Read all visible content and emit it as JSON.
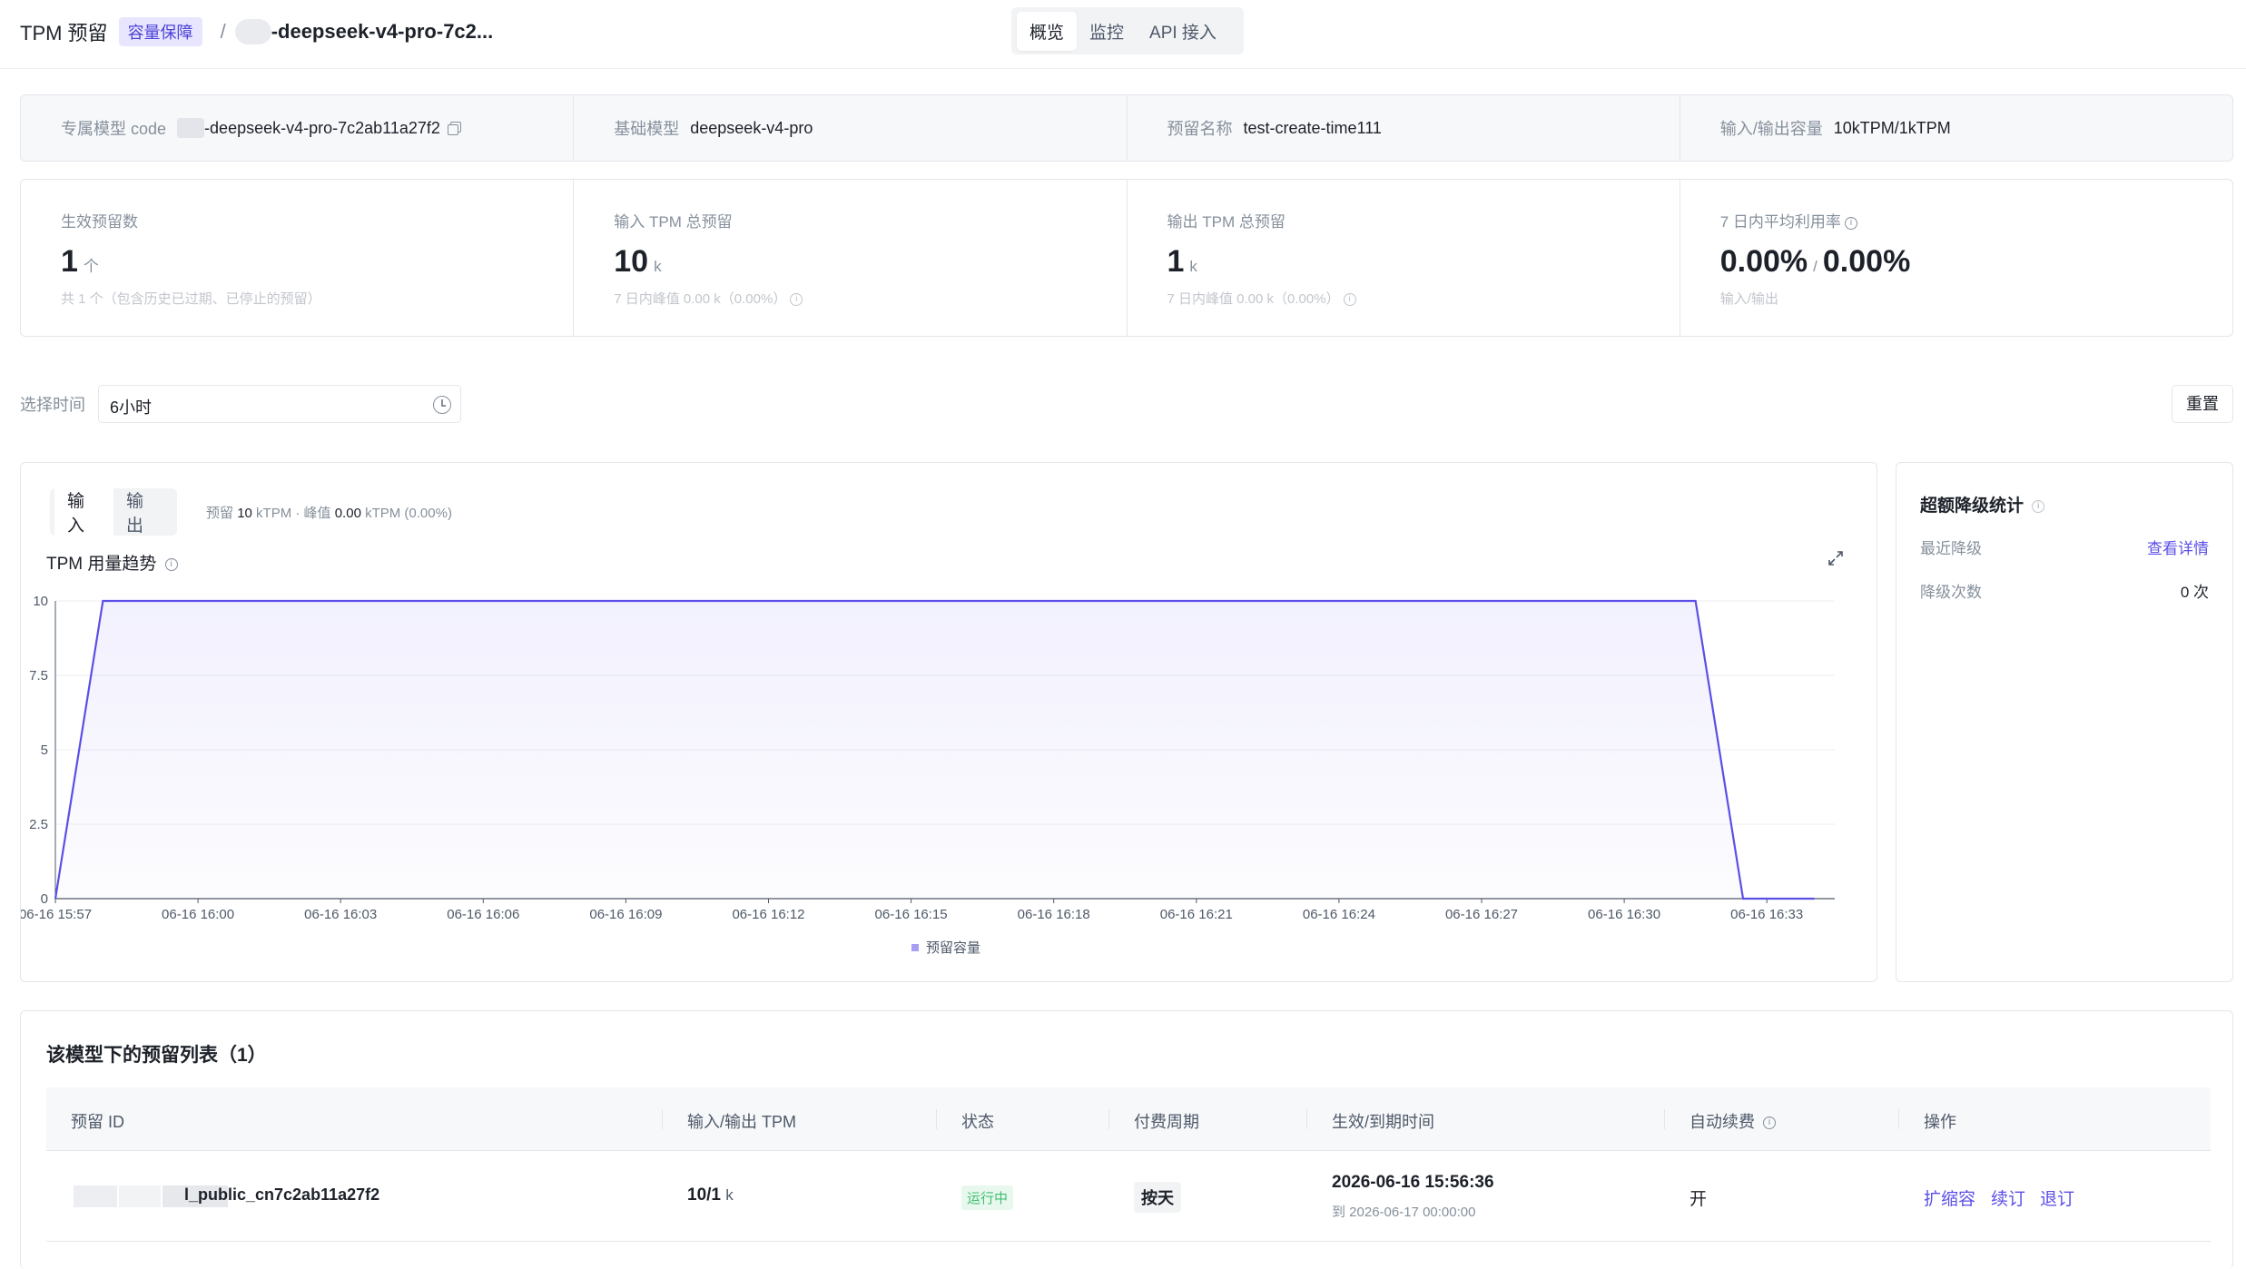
{
  "header": {
    "title": "TPM 预留",
    "badge": "容量保障",
    "separator": "/",
    "model_name": "-deepseek-v4-pro-7c2...",
    "tabs": [
      "概览",
      "监控",
      "API 接入"
    ],
    "active_tab": "概览"
  },
  "info": {
    "model_code_label": "专属模型 code",
    "model_code_value": "-deepseek-v4-pro-7c2ab11a27f2",
    "base_model_label": "基础模型",
    "base_model_value": "deepseek-v4-pro",
    "reserve_name_label": "预留名称",
    "reserve_name_value": "test-create-time111",
    "capacity_label": "输入/输出容量",
    "capacity_value": "10kTPM/1kTPM"
  },
  "stats": {
    "effective": {
      "label": "生效预留数",
      "value": "1",
      "unit": "个",
      "sub": "共 1 个（包含历史已过期、已停止的预留）"
    },
    "input_tpm": {
      "label": "输入 TPM 总预留",
      "value": "10",
      "unit": "k",
      "sub": "7 日内峰值 0.00 k（0.00%）"
    },
    "output_tpm": {
      "label": "输出 TPM 总预留",
      "value": "1",
      "unit": "k",
      "sub": "7 日内峰值 0.00 k（0.00%）"
    },
    "utilization": {
      "label": "7 日内平均利用率",
      "value_in": "0.00%",
      "slash": "/",
      "value_out": "0.00%",
      "sub": "输入/输出"
    }
  },
  "filter": {
    "time_label": "选择时间",
    "time_value": "6小时",
    "reset_label": "重置"
  },
  "chart_panel": {
    "seg_input": "输入",
    "seg_output": "输出",
    "info_prefix": "预留",
    "info_reserve": "10",
    "info_unit1": "kTPM · 峰值",
    "info_peak": "0.00",
    "info_unit2": "kTPM (0.00%)",
    "title": "TPM 用量趋势"
  },
  "chart_data": {
    "type": "area",
    "title": "TPM 用量趋势",
    "xlabel": "",
    "ylabel": "",
    "ylim": [
      0,
      10
    ],
    "yticks": [
      "0",
      "2.5",
      "5",
      "7.5",
      "10"
    ],
    "xticks": [
      "06-16 15:57",
      "06-16 16:00",
      "06-16 16:03",
      "06-16 16:06",
      "06-16 16:09",
      "06-16 16:12",
      "06-16 16:15",
      "06-16 16:18",
      "06-16 16:21",
      "06-16 16:24",
      "06-16 16:27",
      "06-16 16:30",
      "06-16 16:33"
    ],
    "grid": true,
    "legend_position": "bottom",
    "color": "#5b4fe6",
    "series": [
      {
        "name": "预留容量",
        "x_minutes_from_first_tick": [
          0,
          1,
          34.5,
          35.5,
          37
        ],
        "values": [
          0,
          10,
          10,
          0,
          0
        ]
      }
    ]
  },
  "downgrade": {
    "title": "超额降级统计",
    "recent_label": "最近降级",
    "recent_value": "查看详情",
    "count_label": "降级次数",
    "count_value": "0 次"
  },
  "table": {
    "title": "该模型下的预留列表（1）",
    "columns": [
      "预留 ID",
      "输入/输出 TPM",
      "状态",
      "付费周期",
      "生效/到期时间",
      "自动续费",
      "操作"
    ],
    "rows": [
      {
        "id": "l_public_cn7c2ab11a27f2",
        "tpm_value": "10/1",
        "tpm_unit": "k",
        "status": "运行中",
        "billing": "按天",
        "start": "2026-06-16 15:56:36",
        "end": "到 2026-06-17 00:00:00",
        "auto_renew": "开",
        "actions": [
          "扩缩容",
          "续订",
          "退订"
        ]
      }
    ]
  }
}
